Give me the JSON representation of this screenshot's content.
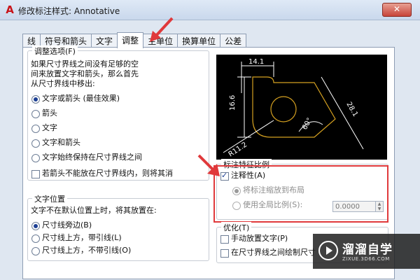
{
  "window": {
    "title": "修改标注样式: Annotative",
    "close_label": "✕"
  },
  "tabs": [
    {
      "label": "线"
    },
    {
      "label": "符号和箭头"
    },
    {
      "label": "文字"
    },
    {
      "label": "调整"
    },
    {
      "label": "主单位"
    },
    {
      "label": "换算单位"
    },
    {
      "label": "公差"
    }
  ],
  "fit_options": {
    "title": "调整选项(F)",
    "desc": [
      "如果尺寸界线之间没有足够的空",
      "间来放置文字和箭头，那么首先",
      "从尺寸界线中移出:"
    ],
    "options": [
      {
        "label": "文字或箭头 (最佳效果)",
        "checked": true
      },
      {
        "label": "箭头",
        "checked": false
      },
      {
        "label": "文字",
        "checked": false
      },
      {
        "label": "文字和箭头",
        "checked": false
      },
      {
        "label": "文字始终保持在尺寸界线之间",
        "checked": false
      }
    ],
    "suppress_label": "若箭头不能放在尺寸界线内，则将其消"
  },
  "text_placement": {
    "title": "文字位置",
    "desc": "文字不在默认位置上时，将其放置在:",
    "options": [
      {
        "label": "尺寸线旁边(B)",
        "checked": true
      },
      {
        "label": "尺寸线上方，带引线(L)",
        "checked": false
      },
      {
        "label": "尺寸线上方，不带引线(O)",
        "checked": false
      }
    ]
  },
  "preview": {
    "dims": [
      "14.1",
      "16.6",
      "28.1",
      "60°",
      "R11.2"
    ]
  },
  "scale": {
    "title": "标注特征比例",
    "annotative_label": "注释性(A)",
    "annotative_checked": true,
    "layout_label": "将标注缩放到布局",
    "global_label": "使用全局比例(S):",
    "global_value": "0.0000"
  },
  "fine_tuning": {
    "title": "优化(T)",
    "manual_label": "手动放置文字(P)",
    "draw_dimline_label": "在尺寸界线之间绘制尺寸"
  },
  "watermark": {
    "title": "溜溜自学",
    "subtitle": "ZIXUE.3D66.COM"
  },
  "colors": {
    "preview_line": "#d4a020",
    "preview_dim": "#ffffff",
    "highlight": "#e0393b"
  }
}
